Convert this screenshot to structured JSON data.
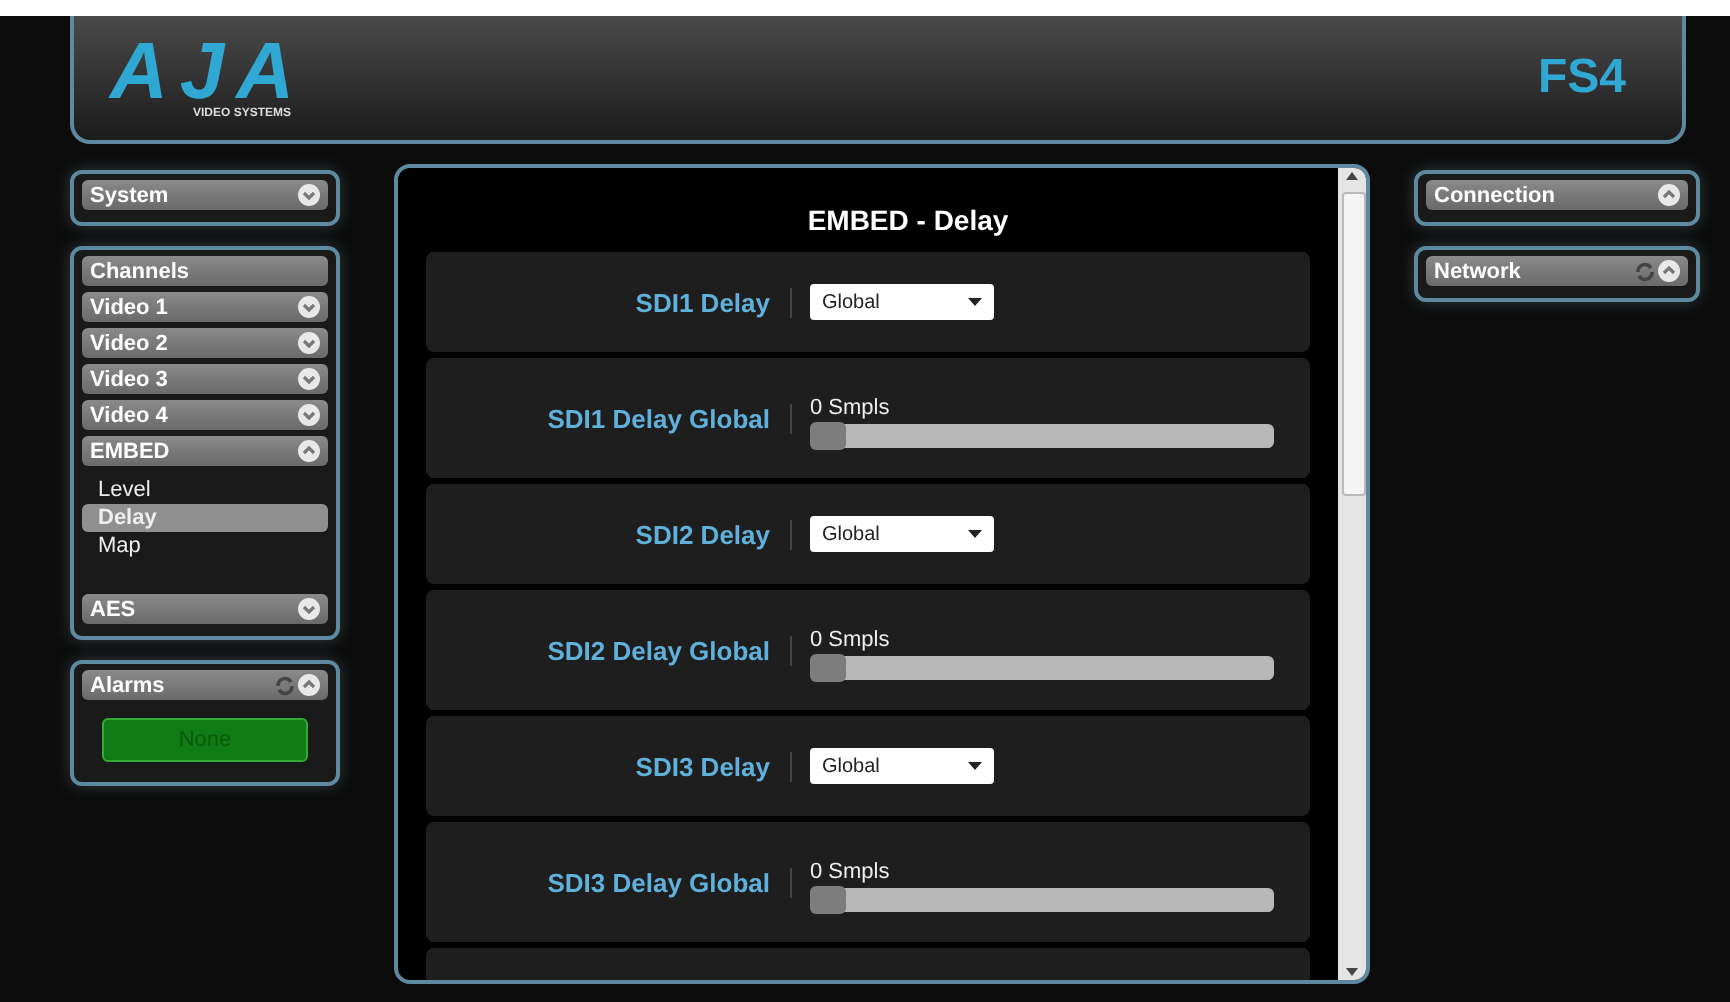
{
  "header": {
    "logo": "AJA",
    "logo_subtitle": "VIDEO SYSTEMS",
    "product": "FS4"
  },
  "left_panels": [
    {
      "title": "System",
      "expanded": false,
      "refresh": false
    },
    {
      "title": "Channels",
      "sections": [
        {
          "label": "Video 1",
          "expanded": false
        },
        {
          "label": "Video 2",
          "expanded": false
        },
        {
          "label": "Video 3",
          "expanded": false
        },
        {
          "label": "Video 4",
          "expanded": false
        },
        {
          "label": "EMBED",
          "expanded": true,
          "children": [
            {
              "label": "Level",
              "selected": false
            },
            {
              "label": "Delay",
              "selected": true
            },
            {
              "label": "Map",
              "selected": false
            }
          ]
        },
        {
          "label": "AES",
          "expanded": false
        }
      ]
    },
    {
      "title": "Alarms",
      "expanded": true,
      "refresh": true,
      "status": "None"
    }
  ],
  "content": {
    "title": "EMBED - Delay",
    "rows": [
      {
        "kind": "select",
        "label": "SDI1 Delay",
        "value": "Global"
      },
      {
        "kind": "slider",
        "label": "SDI1 Delay Global",
        "reading": "0 Smpls",
        "level": 0
      },
      {
        "kind": "select",
        "label": "SDI2 Delay",
        "value": "Global"
      },
      {
        "kind": "slider",
        "label": "SDI2 Delay Global",
        "reading": "0 Smpls",
        "level": 0
      },
      {
        "kind": "select",
        "label": "SDI3 Delay",
        "value": "Global"
      },
      {
        "kind": "slider",
        "label": "SDI3 Delay Global",
        "reading": "0 Smpls",
        "level": 0
      },
      {
        "kind": "empty"
      }
    ]
  },
  "right_panels": [
    {
      "title": "Connection",
      "expanded": true,
      "refresh": false
    },
    {
      "title": "Network",
      "expanded": true,
      "refresh": true
    }
  ]
}
